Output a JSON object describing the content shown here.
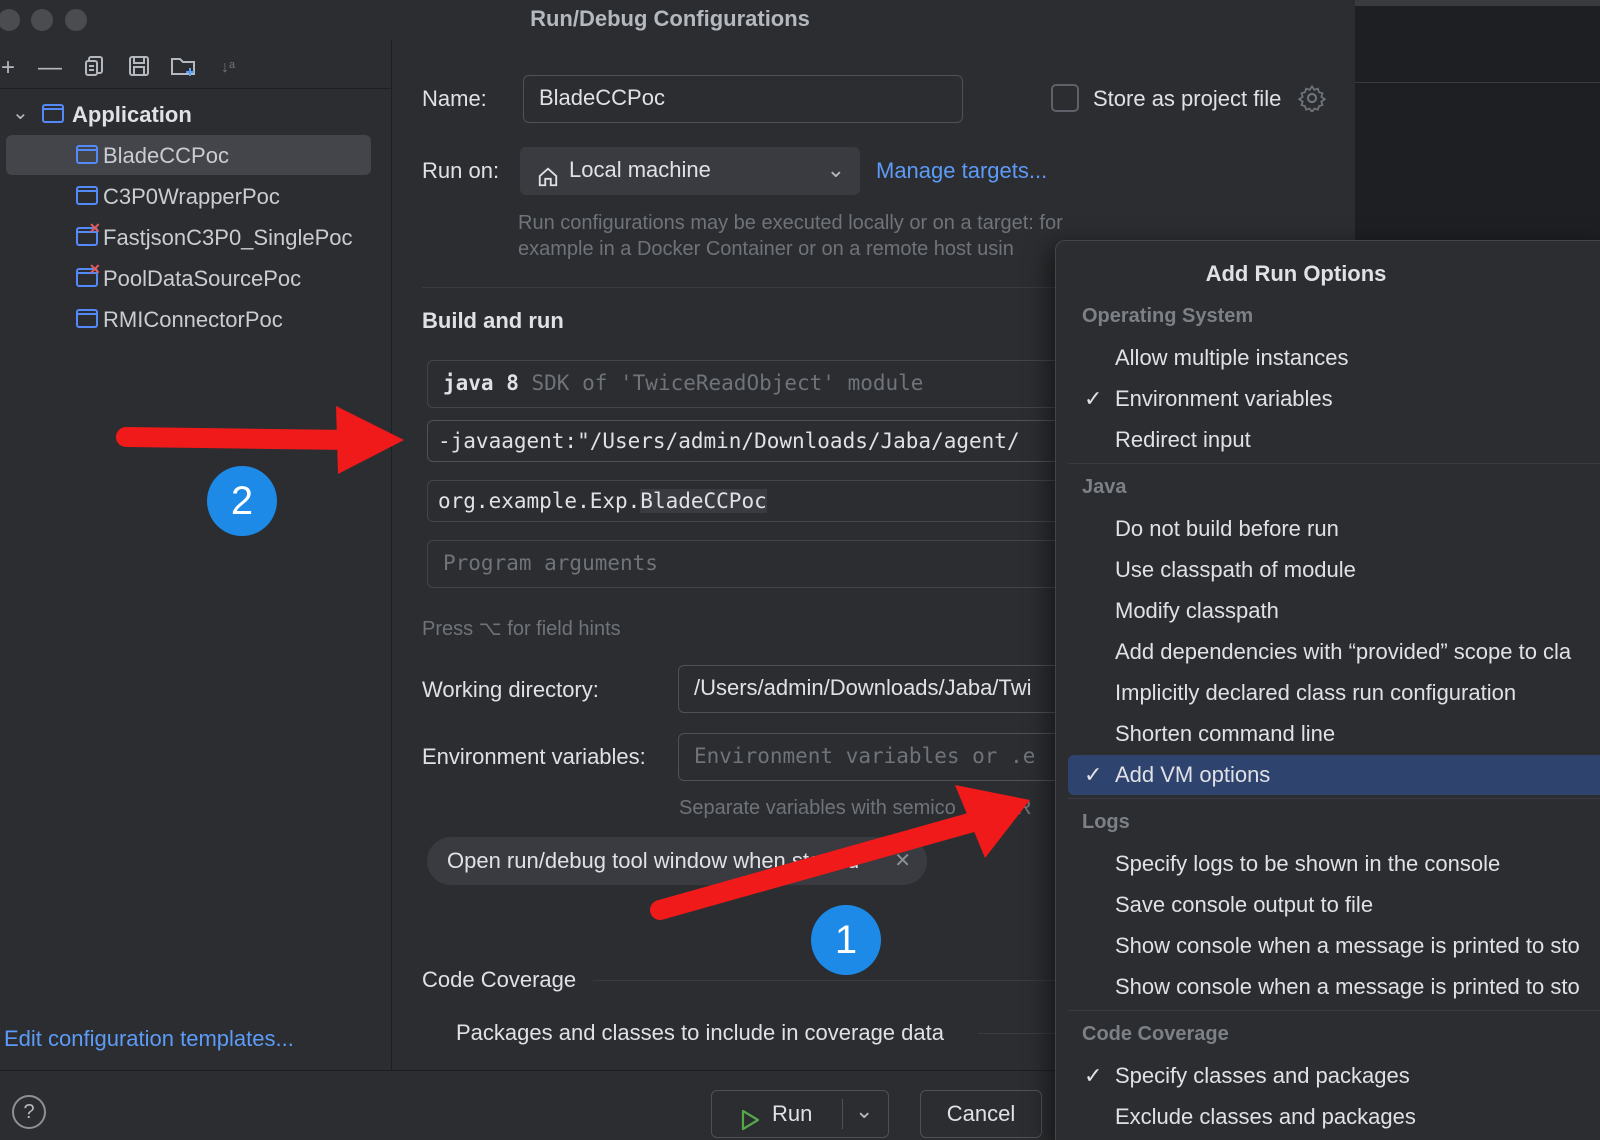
{
  "window": {
    "title": "Run/Debug Configurations"
  },
  "tree": {
    "group": "Application",
    "items": [
      {
        "label": "BladeCCPoc",
        "selected": true,
        "error": false
      },
      {
        "label": "C3P0WrapperPoc",
        "selected": false,
        "error": false
      },
      {
        "label": "FastjsonC3P0_SinglePoc",
        "selected": false,
        "error": true
      },
      {
        "label": "PoolDataSourcePoc",
        "selected": false,
        "error": true
      },
      {
        "label": "RMIConnectorPoc",
        "selected": false,
        "error": false
      }
    ],
    "edit_templates": "Edit configuration templates..."
  },
  "form": {
    "name_label": "Name:",
    "name_value": "BladeCCPoc",
    "store_label": "Store as project file",
    "run_on_label": "Run on:",
    "run_on_value": "Local machine",
    "manage_targets": "Manage targets...",
    "run_on_hint_1": "Run configurations may be executed locally or on a target: for",
    "run_on_hint_2": "example in a Docker Container or on a remote host usin",
    "build_and_run": "Build and run",
    "sdk_java": "java 8",
    "sdk_hint": "SDK of 'TwiceReadObject' module",
    "vm_options": "-javaagent:\"/Users/admin/Downloads/Jaba/agent/",
    "main_class_prefix": "org.example.Exp.",
    "main_class_name": "BladeCCPoc",
    "program_args_placeholder": "Program arguments",
    "field_hints": "Press ⌥ for field hints",
    "working_dir_label": "Working directory:",
    "working_dir_value": "/Users/admin/Downloads/Jaba/Twi",
    "env_label": "Environment variables:",
    "env_placeholder": "Environment variables or .e",
    "env_hint": "Separate variables with semico",
    "env_hint_tail": "VAR",
    "chip_label": "Open run/debug tool window when started",
    "code_coverage": "Code Coverage",
    "coverage_packages": "Packages and classes to include in coverage data"
  },
  "buttons": {
    "run": "Run",
    "cancel": "Cancel",
    "help": "?"
  },
  "popup": {
    "title": "Add Run Options",
    "sections": [
      {
        "name": "Operating System",
        "items": [
          {
            "label": "Allow multiple instances",
            "checked": false
          },
          {
            "label": "Environment variables",
            "checked": true
          },
          {
            "label": "Redirect input",
            "checked": false
          }
        ]
      },
      {
        "name": "Java",
        "items": [
          {
            "label": "Do not build before run",
            "checked": false
          },
          {
            "label": "Use classpath of module",
            "checked": false
          },
          {
            "label": "Modify classpath",
            "checked": false
          },
          {
            "label": "Add dependencies with “provided” scope to cla",
            "checked": false
          },
          {
            "label": "Implicitly declared class run configuration",
            "checked": false
          },
          {
            "label": "Shorten command line",
            "checked": false
          },
          {
            "label": "Add VM options",
            "checked": true,
            "highlighted": true
          }
        ]
      },
      {
        "name": "Logs",
        "items": [
          {
            "label": "Specify logs to be shown in the console",
            "checked": false
          },
          {
            "label": "Save console output to file",
            "checked": false
          },
          {
            "label": "Show console when a message is printed to sto",
            "checked": false
          },
          {
            "label": "Show console when a message is printed to sto",
            "checked": false
          }
        ]
      },
      {
        "name": "Code Coverage",
        "items": [
          {
            "label": "Specify classes and packages",
            "checked": true
          },
          {
            "label": "Exclude classes and packages",
            "checked": false
          }
        ]
      }
    ]
  },
  "annotations": {
    "badge_1": "1",
    "badge_2": "2",
    "arrow_color": "#f01a1a"
  },
  "colors": {
    "accent_link": "#5c9bf7",
    "highlight": "#2e436e",
    "badge": "#1d8ae8"
  }
}
